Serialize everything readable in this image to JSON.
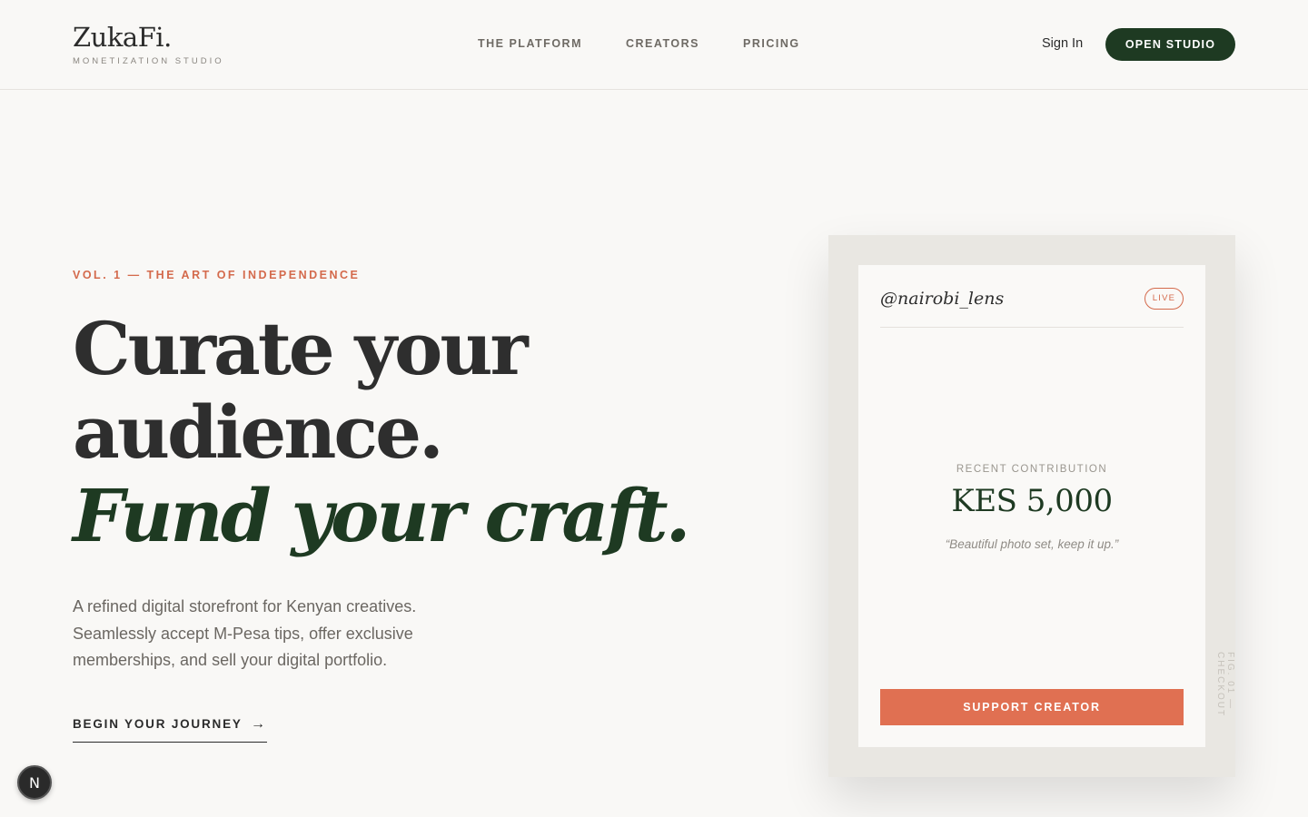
{
  "brand": {
    "name": "ZukaFi.",
    "tagline": "MONETIZATION STUDIO"
  },
  "nav": {
    "items": [
      {
        "label": "THE PLATFORM"
      },
      {
        "label": "CREATORS"
      },
      {
        "label": "PRICING"
      }
    ],
    "sign_in": "Sign In",
    "open_studio": "OPEN STUDIO"
  },
  "hero": {
    "eyebrow": "VOL. 1 — THE ART OF INDEPENDENCE",
    "headline_line1": "Curate your",
    "headline_line2": "audience.",
    "headline_accent": "Fund your craft.",
    "lede": "A refined digital storefront for Kenyan creatives. Seamlessly accept M-Pesa tips, offer exclusive memberships, and sell your digital portfolio.",
    "cta_label": "BEGIN YOUR JOURNEY",
    "cta_arrow": "→"
  },
  "card": {
    "handle": "@nairobi_lens",
    "badge": "LIVE",
    "contribution_label": "RECENT CONTRIBUTION",
    "contribution_amount": "KES 5,000",
    "contribution_note": "“Beautiful photo set, keep it up.”",
    "support_button": "SUPPORT CREATOR",
    "fig_caption": "FIG. 01 — CHECKOUT"
  },
  "floating_badge": {
    "letter": "N"
  },
  "colors": {
    "background": "#f9f8f6",
    "brand_green": "#1e3a22",
    "accent_terracotta": "#e07052"
  }
}
